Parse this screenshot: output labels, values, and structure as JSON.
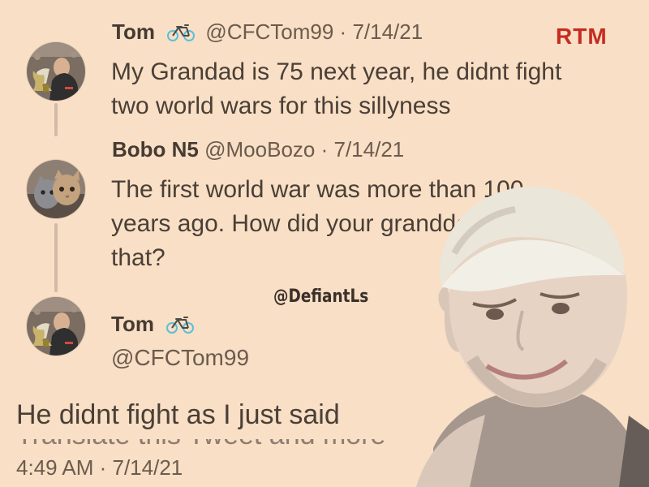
{
  "watermarks": {
    "rtm": "RTM",
    "handle": "@DefiantLs"
  },
  "tweets": [
    {
      "display_name": "Tom",
      "icon": "bicycle-icon",
      "handle": "@CFCTom99",
      "separator": "·",
      "date": "7/14/21",
      "lines": [
        "My Grandad is 75 next year,  he didnt fight",
        "two world wars for this sillyness"
      ]
    },
    {
      "display_name": "Bobo N5",
      "handle": "@MooBozo",
      "separator": "·",
      "date": "7/14/21",
      "lines": [
        "The first world war was more than 100",
        "years ago. How did your granddad fight",
        "that?"
      ]
    }
  ],
  "main_tweet": {
    "display_name": "Tom",
    "icon": "bicycle-icon",
    "handle": "@CFCTom99",
    "text": "He didnt fight as I just said",
    "cut_text": "Translate this Tweet and more",
    "timestamp": "4:49 AM · 7/14/21"
  },
  "colors": {
    "background": "#f8dfc5",
    "text": "#4a3f37",
    "muted": "#6b5b4f",
    "brand_red": "#c62b22"
  }
}
